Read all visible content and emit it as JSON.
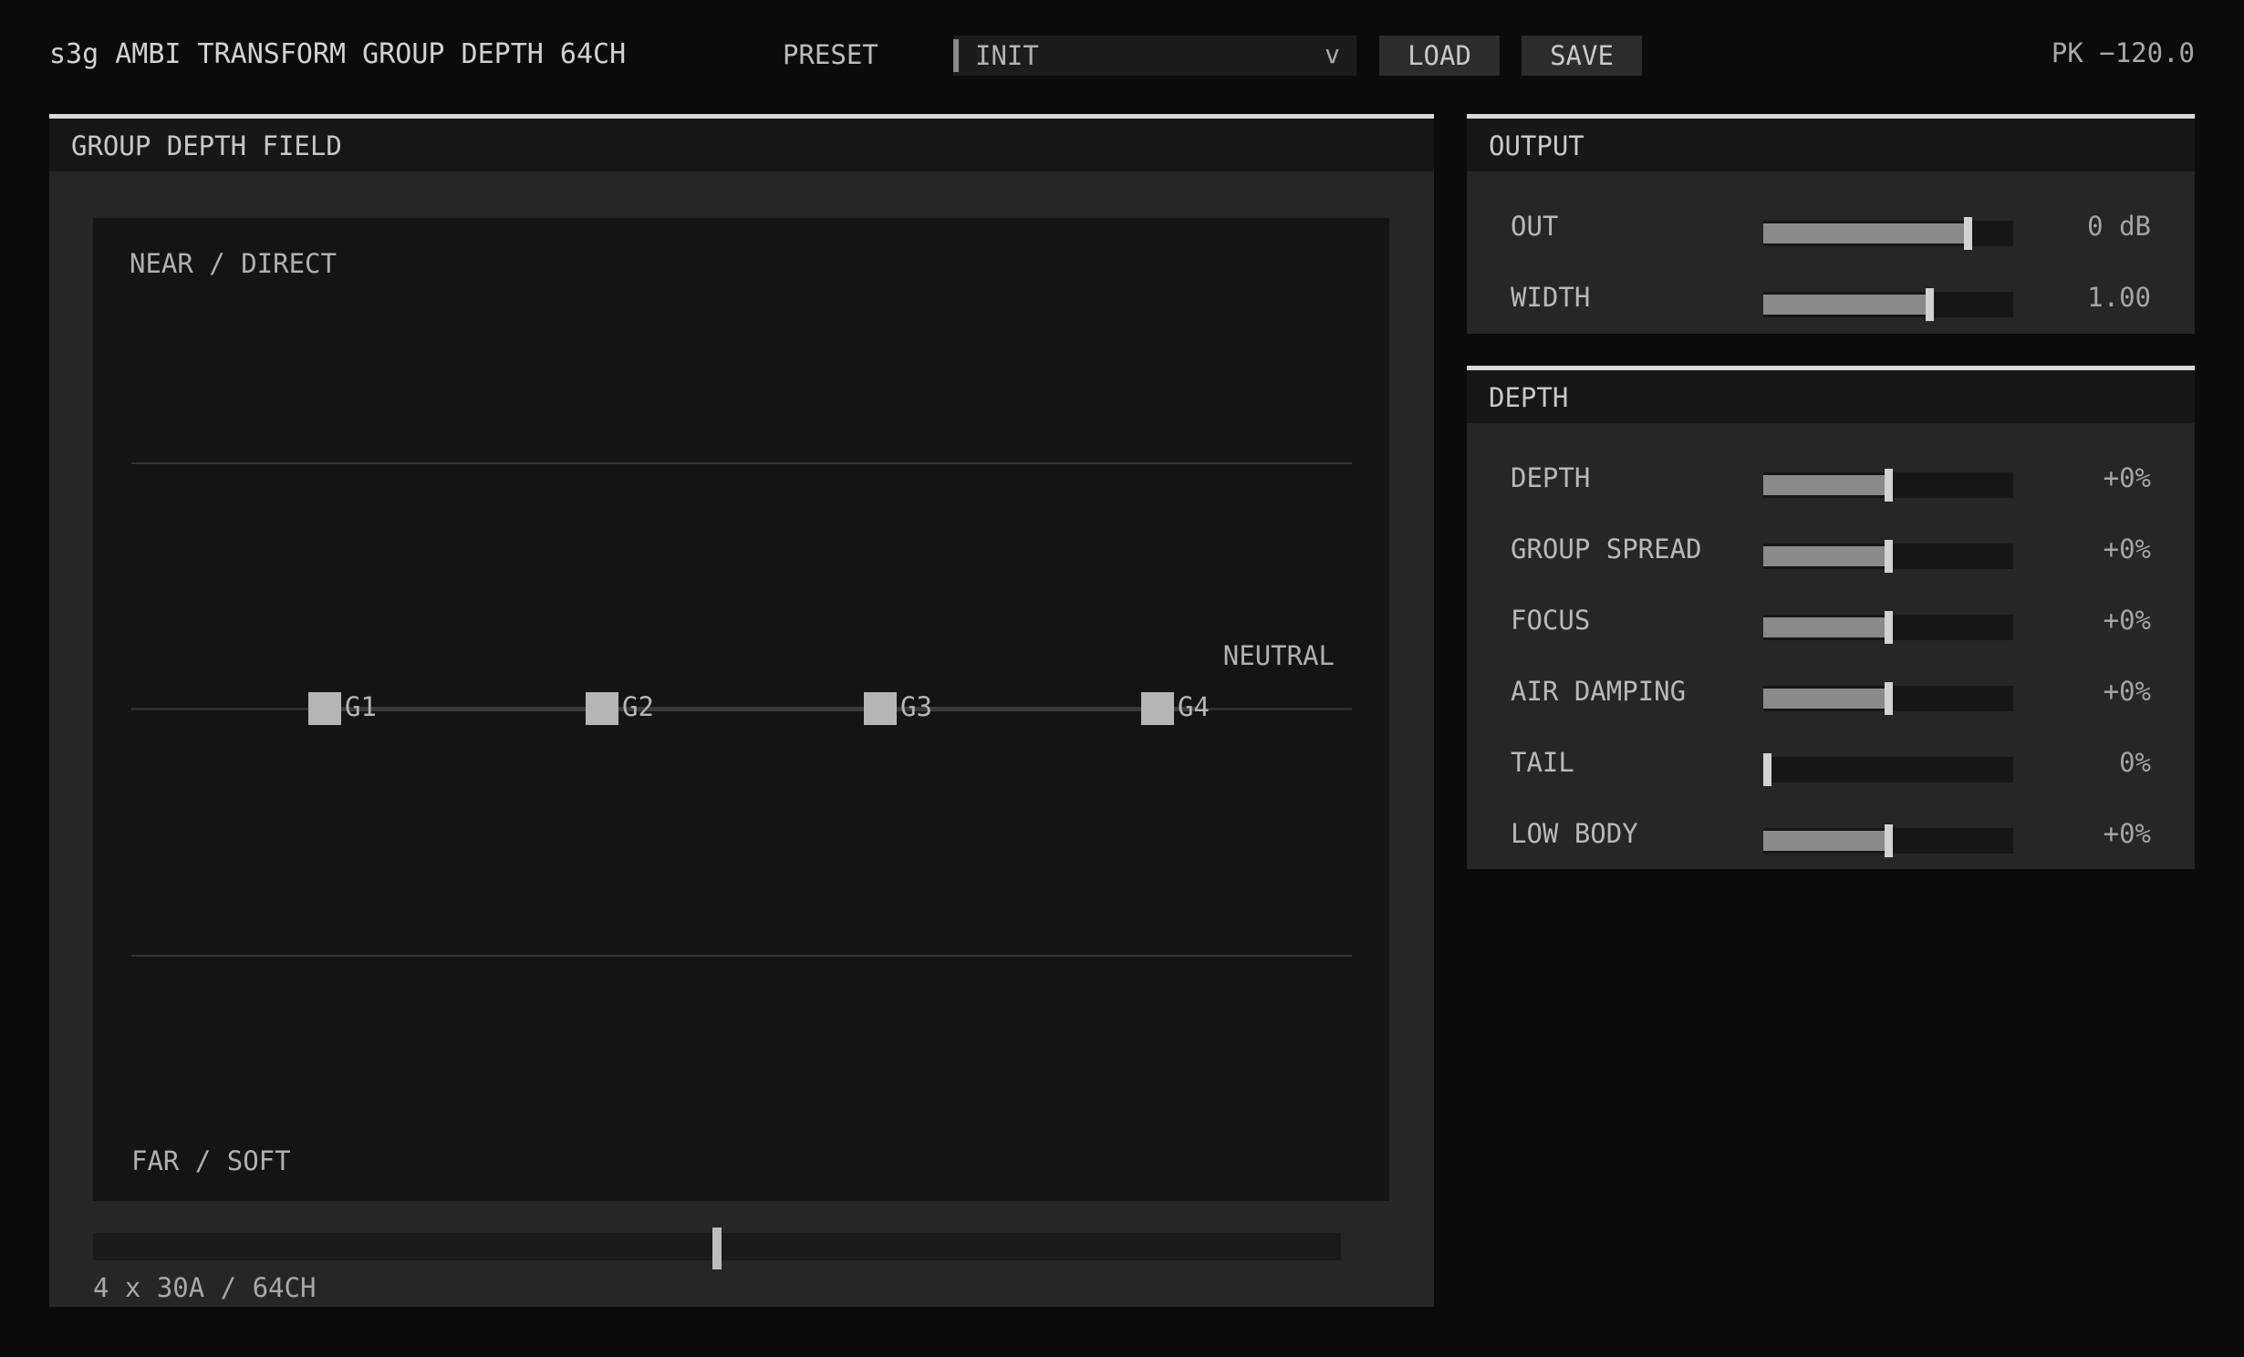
{
  "header": {
    "title": "s3g AMBI TRANSFORM GROUP DEPTH 64CH",
    "preset_label": "PRESET",
    "preset_value": "INIT",
    "preset_chevron": "v",
    "load_label": "LOAD",
    "save_label": "SAVE",
    "peak_readout": "PK −120.0"
  },
  "field": {
    "title": "GROUP DEPTH FIELD",
    "top_label": "NEAR / DIRECT",
    "bottom_label": "FAR / SOFT",
    "neutral_label": "NEUTRAL",
    "groups": [
      {
        "label": "G1"
      },
      {
        "label": "G2"
      },
      {
        "label": "G3"
      },
      {
        "label": "G4"
      }
    ],
    "scroll_position": 0.5,
    "info": "4 x 30A / 64CH"
  },
  "output": {
    "title": "OUTPUT",
    "params": [
      {
        "label": "OUT",
        "value": "0 dB",
        "level": 0.83
      },
      {
        "label": "WIDTH",
        "value": "1.00",
        "level": 0.67
      }
    ]
  },
  "depth": {
    "title": "DEPTH",
    "params": [
      {
        "label": "DEPTH",
        "value": "+0%",
        "level": 0.5
      },
      {
        "label": "GROUP SPREAD",
        "value": "+0%",
        "level": 0.5
      },
      {
        "label": "FOCUS",
        "value": "+0%",
        "level": 0.5
      },
      {
        "label": "AIR DAMPING",
        "value": "+0%",
        "level": 0.5
      },
      {
        "label": "TAIL",
        "value": "0%",
        "level": 0.0
      },
      {
        "label": "LOW BODY",
        "value": "+0%",
        "level": 0.5
      }
    ]
  },
  "colors": {
    "background": "#0b0b0b",
    "panel": "#262626",
    "accent": "#d9d9d9",
    "node": "#b5b5b5"
  }
}
